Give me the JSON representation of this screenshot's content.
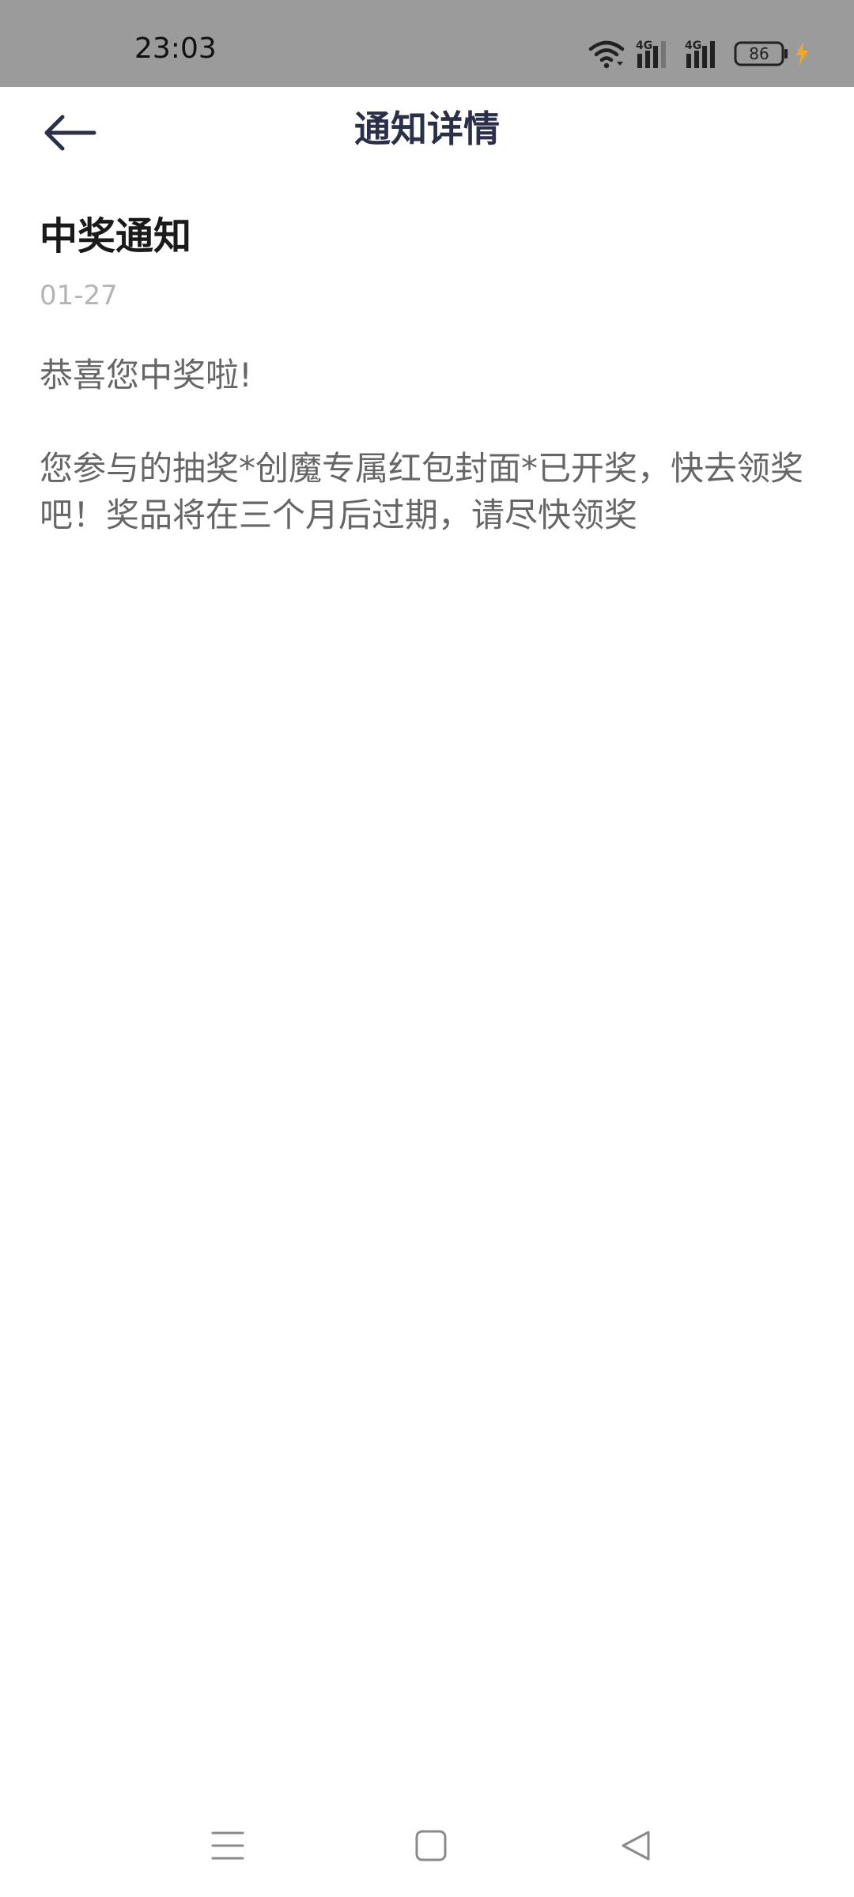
{
  "status_bar": {
    "time": "23:03",
    "battery_level": "86",
    "icons": [
      "wifi-icon",
      "signal-4g-icon",
      "signal-4g-icon",
      "battery-icon",
      "charging-bolt-icon"
    ],
    "colors": {
      "background": "#9b9b9b",
      "bolt": "#f5a623"
    }
  },
  "header": {
    "title": "通知详情",
    "back_icon": "back-arrow-icon"
  },
  "notice": {
    "title": "中奖通知",
    "date": "01-27",
    "paragraphs": [
      "恭喜您中奖啦!",
      "您参与的抽奖*创魔专属红包封面*已开奖，快去领奖吧！奖品将在三个月后过期，请尽快领奖"
    ]
  },
  "nav_bar": {
    "icons": [
      "menu-icon",
      "home-square-icon",
      "back-triangle-icon"
    ]
  },
  "colors": {
    "title": "#2a2f4a",
    "body_text": "#666666",
    "date_text": "#b4b4b4"
  }
}
